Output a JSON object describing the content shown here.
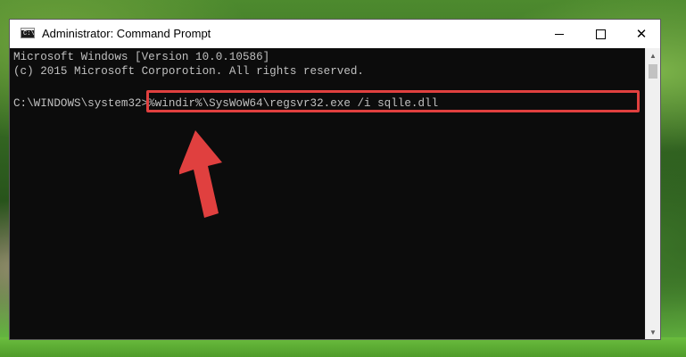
{
  "window": {
    "title": "Administrator: Command Prompt",
    "app_icon_glyph": "C:\\"
  },
  "controls": {
    "minimize_icon": "minimize-icon",
    "maximize_icon": "maximize-icon",
    "close_icon": "close-icon",
    "close_glyph": "✕"
  },
  "console": {
    "line1": "Microsoft Windows [Version 10.0.10586]",
    "line2": "(c) 2015 Microsoft Corporotion. All rights reserved.",
    "prompt": "C:\\WINDOWS\\system32>",
    "command": "%windir%\\SysWoW64\\regsvr32.exe /i sqlle.dll"
  },
  "scrollbar": {
    "up_glyph": "▲",
    "down_glyph": "▼"
  },
  "colors": {
    "console_background": "#0c0c0c",
    "console_text": "#c0c0c0",
    "highlight": "#e0403f"
  }
}
